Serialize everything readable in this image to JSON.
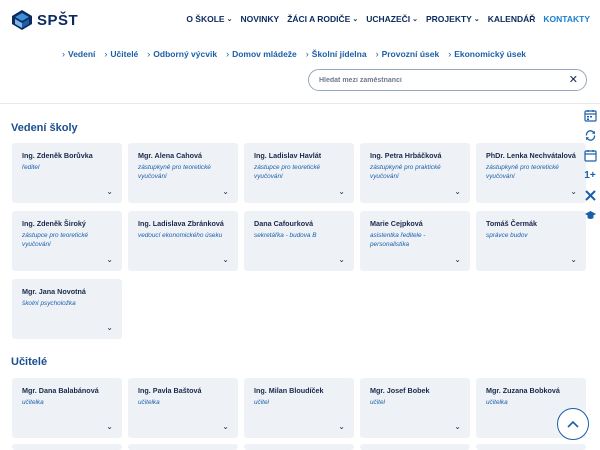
{
  "brand": {
    "name": "SPŠT"
  },
  "nav": [
    {
      "label": "O ŠKOLE",
      "dropdown": true
    },
    {
      "label": "NOVINKY",
      "dropdown": false
    },
    {
      "label": "ŽÁCI A RODIČE",
      "dropdown": true
    },
    {
      "label": "UCHAZEČI",
      "dropdown": true
    },
    {
      "label": "PROJEKTY",
      "dropdown": true
    },
    {
      "label": "KALENDÁŘ",
      "dropdown": false
    },
    {
      "label": "KONTAKTY",
      "dropdown": false,
      "active": true
    }
  ],
  "subnav": [
    "Vedení",
    "Učitelé",
    "Odborný výcvik",
    "Domov mládeže",
    "Školní jídelna",
    "Provozní úsek",
    "Ekonomický úsek"
  ],
  "search": {
    "placeholder": "Hledat mezi zaměstnanci",
    "value": ""
  },
  "sections": {
    "vedeni": {
      "title": "Vedení školy",
      "cards": [
        {
          "name": "Ing. Zdeněk Borůvka",
          "role": "ředitel"
        },
        {
          "name": "Mgr. Alena Cahová",
          "role": "zástupkyně pro teoretické vyučování"
        },
        {
          "name": "Ing. Ladislav Havlát",
          "role": "zástupce pro teoretické vyučování"
        },
        {
          "name": "Ing. Petra Hrbáčková",
          "role": "zástupkyně pro praktické vyučování"
        },
        {
          "name": "PhDr. Lenka Nechvátalová",
          "role": "zástupkyně pro teoretické vyučování"
        },
        {
          "name": "Ing. Zdeněk Široký",
          "role": "zástupce pro teoretické vyučování"
        },
        {
          "name": "Ing. Ladislava Zbránková",
          "role": "vedoucí ekonomického úseku"
        },
        {
          "name": "Dana Cafourková",
          "role": "sekretářka - budova B"
        },
        {
          "name": "Marie Cejpková",
          "role": "asistentka ředitele - personalistika"
        },
        {
          "name": "Tomáš Čermák",
          "role": "správce budov"
        },
        {
          "name": "Mgr. Jana Novotná",
          "role": "školní psycholožka"
        }
      ]
    },
    "ucitele": {
      "title": "Učitelé",
      "cards": [
        {
          "name": "Mgr. Dana Balabánová",
          "role": "učitelka"
        },
        {
          "name": "Ing. Pavla Baštová",
          "role": "učitelka"
        },
        {
          "name": "Ing. Milan Bloudíček",
          "role": "učitel"
        },
        {
          "name": "Mgr. Josef Bobek",
          "role": "učitel"
        },
        {
          "name": "Mgr. Zuzana Bobková",
          "role": "učitelka"
        }
      ]
    }
  },
  "side_tools": [
    "calendar-check-icon",
    "refresh-icon",
    "calendar-icon",
    "plus-one-icon",
    "cross-tools-icon",
    "graduation-cap-icon"
  ],
  "side_tools_text": {
    "plus_one": "1+"
  },
  "colors": {
    "primary": "#0b2a5e",
    "accent": "#1a7fd0",
    "link": "#1a5fa8",
    "card_bg": "#eef2f7"
  }
}
